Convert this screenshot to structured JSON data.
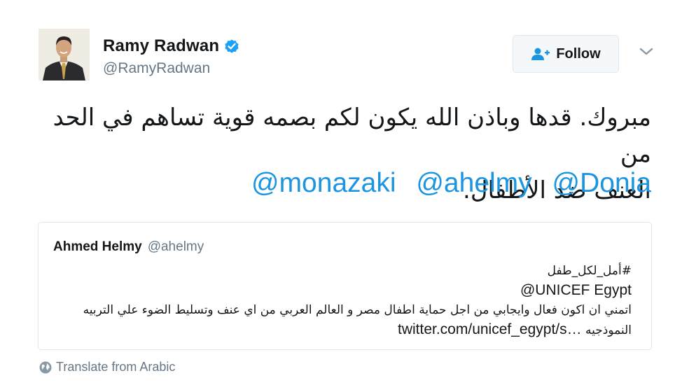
{
  "author": {
    "display_name": "Ramy Radwan",
    "handle": "@RamyRadwan",
    "verified": true
  },
  "follow_button": {
    "label": "Follow"
  },
  "tweet": {
    "text_line1": "مبروك. قدها وباذن الله يكون لكم بصمه قوية تساهم في الحد من",
    "text_line2": "العنف ضد الأطفال.",
    "mentions": [
      "@monazaki",
      "@ahelmy",
      "@Donia"
    ]
  },
  "quoted_tweet": {
    "display_name": "Ahmed Helmy",
    "handle": "@ahelmy",
    "hashtag_line": "#أمل_لكل_طفل",
    "mention_line": "@UNICEF Egypt",
    "body_line1": "اتمني ان اكون فعال وايجابي من اجل حماية اطفال مصر و العالم العربي من اي عنف وتسليط الضوء علي التربيه",
    "body_line2_arabic": "النموذجيه",
    "body_line2_link": "twitter.com/unicef_egypt/s…"
  },
  "translate": {
    "label": "Translate from Arabic"
  },
  "colors": {
    "link": "#1b95e0",
    "secondary_text": "#657786",
    "border": "#e1e8ed",
    "verified": "#1da1f2"
  }
}
